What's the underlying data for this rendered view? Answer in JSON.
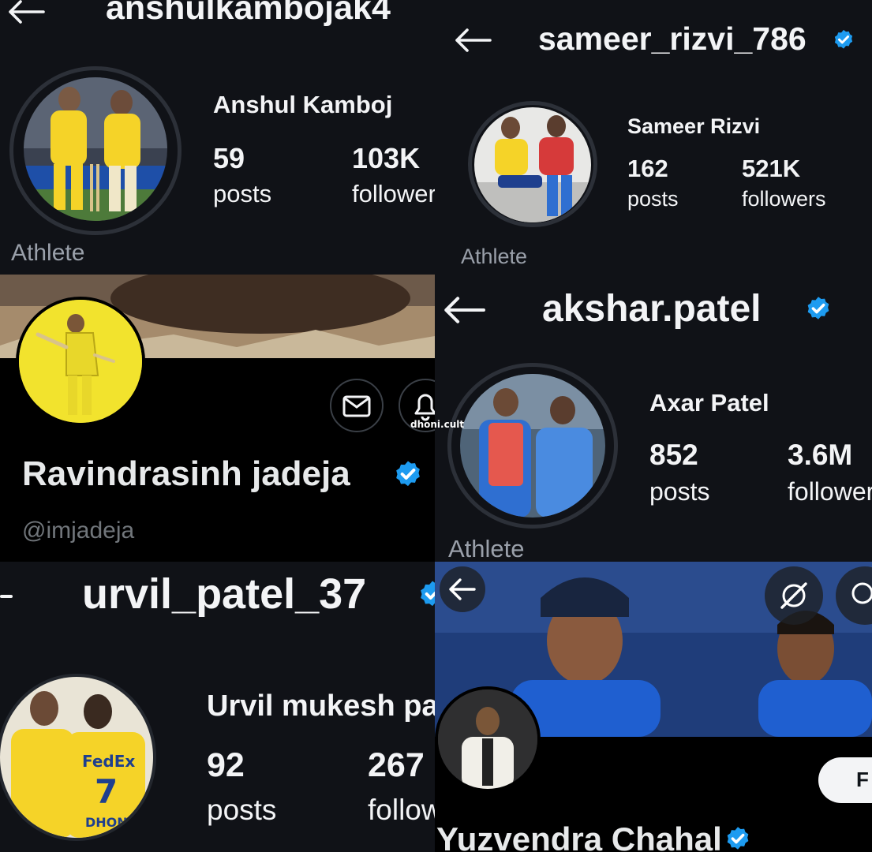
{
  "colors": {
    "background": "#101217",
    "verified": "#1d9bf0",
    "text": "#f3f4f6",
    "muted": "#9aa0aa",
    "jersey_yellow": "#f5d328",
    "jersey_blue": "#1e5bb8"
  },
  "icons": {
    "back": "arrow-left-icon",
    "verified": "verified-badge-icon",
    "mail": "mail-icon",
    "bell": "bell-icon",
    "more": "more-icon"
  },
  "watermark": "dhoni.cult",
  "p1": {
    "username": "anshulkambojak4",
    "name": "Anshul Kamboj",
    "posts_count": "59",
    "posts_label": "posts",
    "followers_count": "103K",
    "followers_label": "followers",
    "category": "Athlete"
  },
  "p2": {
    "username": "sameer_rizvi_786",
    "name": "Sameer Rizvi",
    "posts_count": "162",
    "posts_label": "posts",
    "followers_count": "521K",
    "followers_label": "followers",
    "category": "Athlete"
  },
  "p3": {
    "name": "Ravindrasinh jadeja",
    "handle": "@imjadeja"
  },
  "p4": {
    "username": "akshar.patel",
    "name": "Axar Patel",
    "posts_count": "852",
    "posts_label": "posts",
    "followers_count": "3.6M",
    "followers_label": "followers",
    "category": "Athlete"
  },
  "p5": {
    "username": "urvil_patel_37",
    "name": "Urvil mukesh pa",
    "posts_count": "92",
    "posts_label": "posts",
    "followers_count": "267",
    "followers_label": "followers"
  },
  "p6": {
    "name": "Yuzvendra Chahal",
    "follow_label": "F"
  }
}
